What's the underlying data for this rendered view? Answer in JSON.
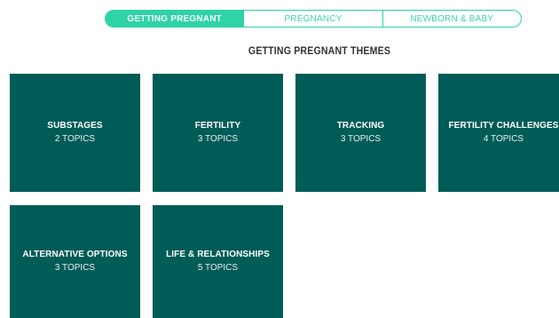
{
  "tabs": [
    {
      "label": "GETTING PREGNANT",
      "active": true
    },
    {
      "label": "PREGNANCY",
      "active": false
    },
    {
      "label": "NEWBORN & BABY",
      "active": false
    }
  ],
  "section_title": "GETTING PREGNANT THEMES",
  "themes": [
    {
      "title": "SUBSTAGES",
      "count": "2 TOPICS"
    },
    {
      "title": "FERTILITY",
      "count": "3 TOPICS"
    },
    {
      "title": "TRACKING",
      "count": "3 TOPICS"
    },
    {
      "title": "FERTILITY CHALLENGES",
      "count": "4 TOPICS"
    },
    {
      "title": "ALTERNATIVE OPTIONS",
      "count": "3 TOPICS"
    },
    {
      "title": "LIFE & RELATIONSHIPS",
      "count": "5 TOPICS"
    }
  ],
  "colors": {
    "accent": "#2ed3a6",
    "card_bg": "#005c57",
    "title_text": "#333333"
  }
}
